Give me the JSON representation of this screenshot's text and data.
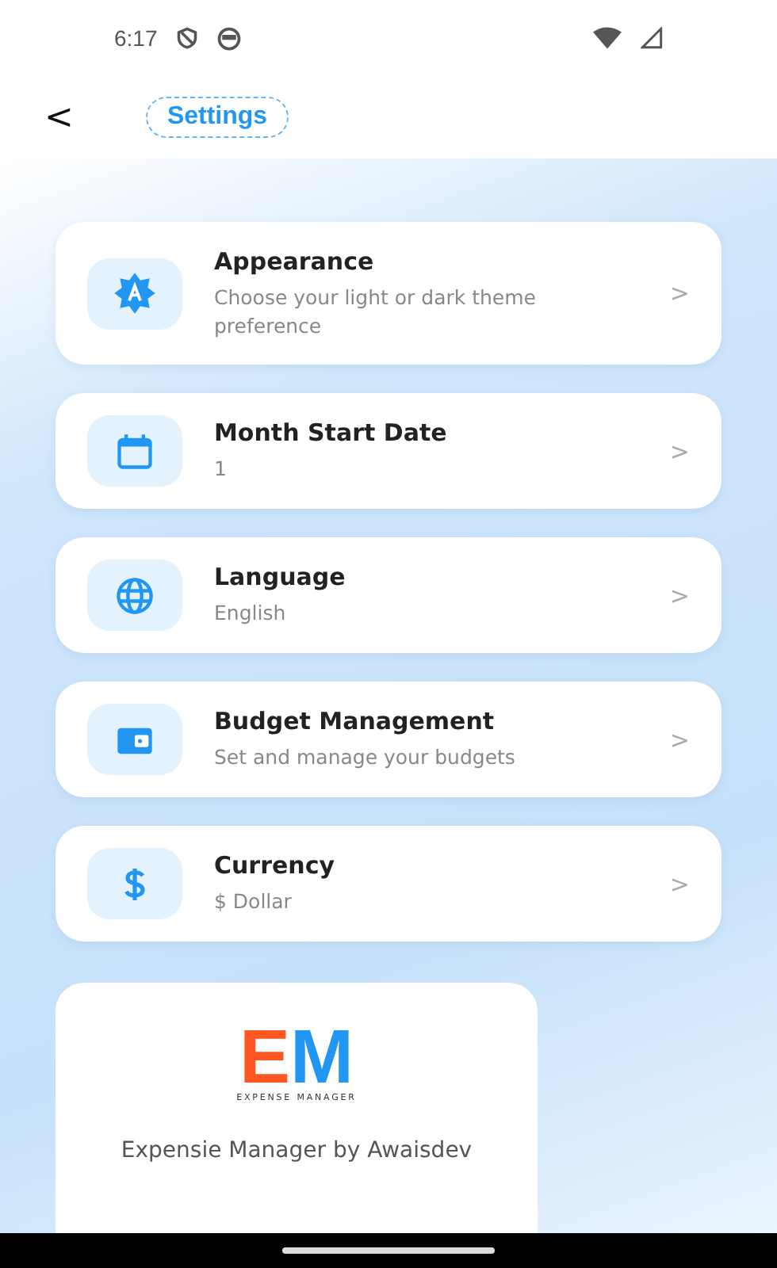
{
  "status_bar": {
    "time": "6:17"
  },
  "header": {
    "back": "<",
    "title": "Settings"
  },
  "settings": [
    {
      "kind": "appearance",
      "title": "Appearance",
      "subtitle": "Choose your light or dark theme preference",
      "chevron": ">"
    },
    {
      "kind": "calendar",
      "title": "Month Start Date",
      "subtitle": "1",
      "chevron": ">"
    },
    {
      "kind": "language",
      "title": "Language",
      "subtitle": "English",
      "chevron": ">"
    },
    {
      "kind": "wallet",
      "title": "Budget Management",
      "subtitle": "Set and manage your budgets",
      "chevron": ">"
    },
    {
      "kind": "currency",
      "title": "Currency",
      "subtitle": "$ Dollar",
      "chevron": ">"
    }
  ],
  "about": {
    "logo_left": "E",
    "logo_right": "M",
    "logo_caption": "EXPENSE MANAGER",
    "app_name": "Expensie Manager by Awaisdev"
  }
}
